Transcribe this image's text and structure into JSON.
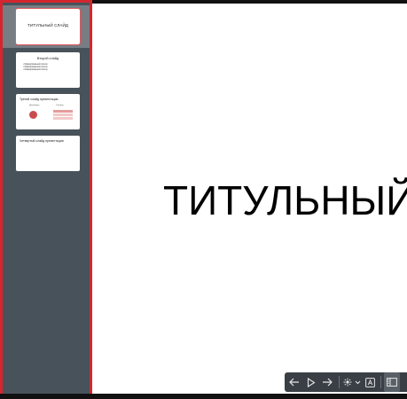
{
  "slides": [
    {
      "title": "ТИТУЛЬНЫЙ СЛАЙД",
      "selected": true
    },
    {
      "title": "Второй слайд",
      "bullets": [
        "Маркированный список",
        "Маркированный список",
        "Маркированный список"
      ]
    },
    {
      "title": "Третий слайд презентации",
      "columns": [
        "Диаграмма",
        "Таблица"
      ]
    },
    {
      "title": "Четвертый слайд презентации"
    }
  ],
  "main_slide": {
    "title": "ТИТУЛЬНЫЙ СЛАЙД"
  },
  "controls": [
    {
      "name": "previous-slide-button",
      "icon": "arrow-left-icon"
    },
    {
      "name": "play-button",
      "icon": "play-icon"
    },
    {
      "name": "next-slide-button",
      "icon": "arrow-right-icon"
    },
    {
      "name": "pointer-tool-button",
      "icon": "laser-pointer-icon"
    },
    {
      "name": "pointer-options-dropdown",
      "icon": "chevron-down-icon"
    },
    {
      "name": "subtitles-button",
      "icon": "subtitles-icon"
    },
    {
      "name": "slide-panel-toggle",
      "icon": "sidebar-panel-icon"
    }
  ],
  "colors": {
    "sidebar": "#48525a",
    "highlight": "#d4262e",
    "controls": "#3a3f45"
  }
}
